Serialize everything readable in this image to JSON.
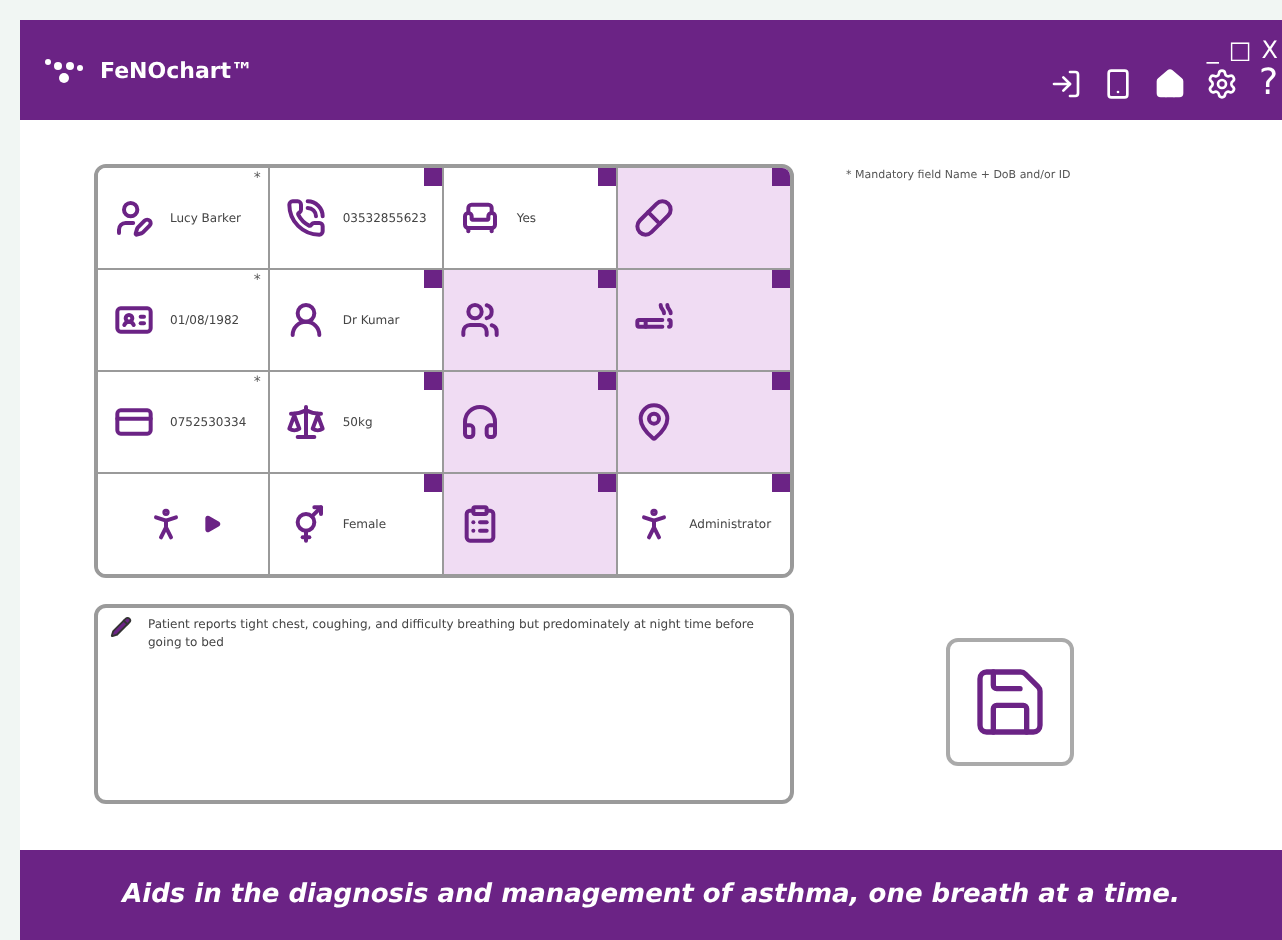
{
  "window": {
    "title": "FeNOchart™",
    "controls": [
      "_",
      "□",
      "X"
    ]
  },
  "toolbar": {
    "help": "?"
  },
  "fields": [
    {
      "value": "Lucy Barker",
      "marker": "*",
      "filled": true,
      "clearable": false
    },
    {
      "value": "03532855623",
      "filled": true,
      "clearable": true
    },
    {
      "value": "Yes",
      "filled": true,
      "clearable": true
    },
    {
      "filled": false,
      "clearable": true
    },
    {
      "value": "01/08/1982",
      "marker": "*",
      "filled": true,
      "clearable": false
    },
    {
      "value": "Dr Kumar",
      "filled": true,
      "clearable": true
    },
    {
      "filled": false,
      "clearable": true
    },
    {
      "filled": false,
      "clearable": true
    },
    {
      "value": "0752530334",
      "marker": "*",
      "filled": true,
      "clearable": false
    },
    {
      "value": "50kg",
      "filled": true,
      "clearable": true
    },
    {
      "filled": false,
      "clearable": true
    },
    {
      "filled": false,
      "clearable": true
    },
    {
      "filled": true,
      "clearable": false
    },
    {
      "value": "Female",
      "filled": true,
      "clearable": true
    },
    {
      "filled": false,
      "clearable": true
    },
    {
      "value": "Administrator",
      "filled": true,
      "clearable": true
    }
  ],
  "notes": {
    "value": "Patient reports tight chest, coughing, and difficulty breathing but predominately at night time before going to bed"
  },
  "mandatory_note": "* Mandatory field Name + DoB and/or ID",
  "footer": "Aids in the diagnosis and management of asthma, one breath at a time."
}
